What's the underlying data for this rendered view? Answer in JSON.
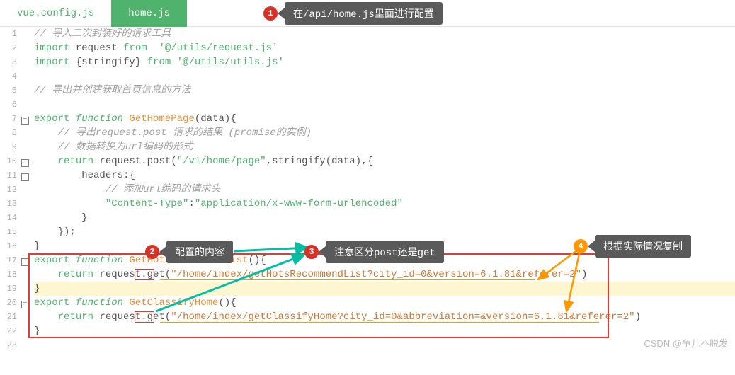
{
  "tabs": {
    "inactive": "vue.config.js",
    "active": "home.js"
  },
  "callouts": {
    "c1": "在/api/home.js里面进行配置",
    "c2": "配置的内容",
    "c3": "注意区分post还是get",
    "c4": "根据实际情况复制"
  },
  "markers": {
    "m1": "1",
    "m2": "2",
    "m3": "3",
    "m4": "4"
  },
  "code": {
    "l1": "// 导入二次封装好的请求工具",
    "l2a": "import",
    "l2b": " request ",
    "l2c": "from",
    "l2d": "  '@/utils/request.js'",
    "l3a": "import",
    "l3b": " {stringify} ",
    "l3c": "from",
    "l3d": " '@/utils/utils.js'",
    "l5": "// 导出并创建获取首页信息的方法",
    "l7a": "export ",
    "l7b": "function",
    "l7c": " GetHomePage",
    "l7d": "(data){",
    "l8": "// 导出request.post 请求的结果 (promise的实例)",
    "l9": "// 数据转换为url编码的形式",
    "l10a": "return",
    "l10b": " request.post(",
    "l10c": "\"/v1/home/page\"",
    "l10d": ",stringify(data),{",
    "l11": "headers:{",
    "l12": "// 添加url编码的请求头",
    "l13a": "\"Content-Type\"",
    "l13b": ":",
    "l13c": "\"application/x-www-form-urlencoded\"",
    "l14": "}",
    "l15": "});",
    "l16": "}",
    "l17a": "export ",
    "l17b": "function",
    "l17c": " GetHotsRecommendList",
    "l17d": "(){",
    "l18a": "return",
    "l18b": " request.",
    "l18c": "get",
    "l18d": "(",
    "l18e": "\"/home/index/getHotsRecommendList?city_id=0&version=6.1.81&referer=2\"",
    "l18f": ")",
    "l19": "}",
    "l20a": "export ",
    "l20b": "function",
    "l20c": " GetClassifyHome",
    "l20d": "(){",
    "l21a": "return",
    "l21b": " request.",
    "l21c": "get",
    "l21d": "(",
    "l21e": "\"/home/index/getClassifyHome?city_id=0&abbreviation=&version=6.1.81&referer=2\"",
    "l21f": ")",
    "l22": "}"
  },
  "lines": [
    "1",
    "2",
    "3",
    "4",
    "5",
    "6",
    "7",
    "8",
    "9",
    "10",
    "11",
    "12",
    "13",
    "14",
    "15",
    "16",
    "17",
    "18",
    "19",
    "20",
    "21",
    "22",
    "23"
  ],
  "watermark": "CSDN @争儿不脱发"
}
